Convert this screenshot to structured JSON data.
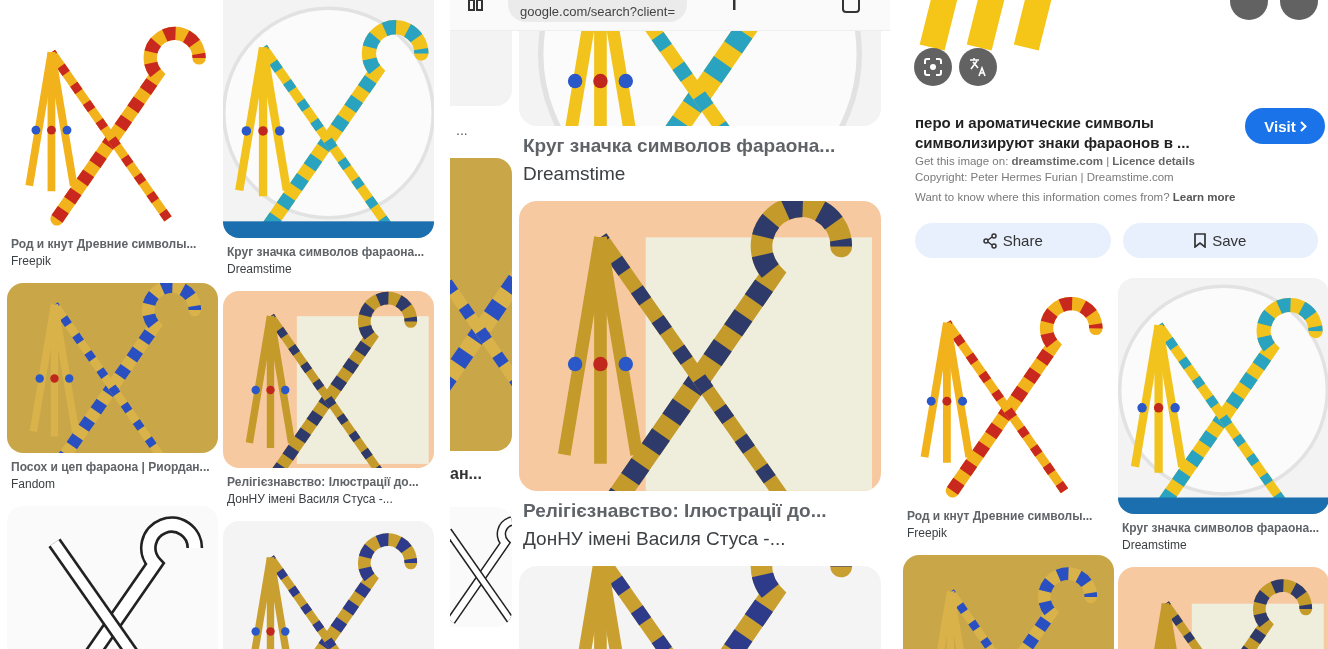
{
  "left_screen": {
    "columns": [
      [
        {
          "kind": "colored",
          "title": "Род и кнут Древние символы...",
          "source": "Freepik"
        },
        {
          "kind": "sand",
          "title": "Посох и цеп фараона | Риордан...",
          "source": "Fandom"
        },
        {
          "kind": "outline"
        }
      ],
      [
        {
          "kind": "plate",
          "title": "Круг значка символов фараона...",
          "source": "Dreamstime"
        },
        {
          "kind": "slide",
          "title": "Релігієзнавство: Ілюстрації до...",
          "source": "ДонНУ імені Василя Стуса -..."
        },
        {
          "kind": "textslide"
        }
      ]
    ]
  },
  "middle_screen": {
    "address_bar": {
      "url": "google.com/search?client="
    },
    "side_column": [
      {
        "kind": "blank"
      },
      {
        "text": "..."
      },
      {
        "kind": "sand"
      },
      {
        "text": "ан..."
      },
      {
        "kind": "outline"
      }
    ],
    "results": [
      {
        "kind": "plate",
        "title": "Круг значка символов фараона...",
        "source": "Dreamstime"
      },
      {
        "kind": "slide",
        "title": "Релігієзнавство: Ілюстрації до...",
        "source": "ДонНУ імені Василя Стуса -..."
      },
      {
        "kind": "textslide"
      }
    ]
  },
  "right_screen": {
    "preview": {
      "kind": "partial"
    },
    "title": "перо и ароматические символы символизируют знаки фараонов в ...",
    "visit_button": "Visit",
    "source_line": "Get this image on: **dreamstime.com** | **Licence details**",
    "copyright": "Copyright: Peter Hermes Furian | Dreamstime.com",
    "info_line": {
      "text": "Want to know where this information comes from?",
      "link": "Learn more"
    },
    "actions": [
      {
        "kind": "share",
        "label": "Share"
      },
      {
        "kind": "save",
        "label": "Save"
      }
    ],
    "columns": [
      [
        {
          "kind": "colored",
          "title": "Род и кнут Древние символы...",
          "source": "Freepik"
        },
        {
          "kind": "sand"
        }
      ],
      [
        {
          "kind": "plate",
          "title": "Круг значка символов фараона...",
          "source": "Dreamstime"
        },
        {
          "kind": "slide"
        }
      ]
    ]
  }
}
